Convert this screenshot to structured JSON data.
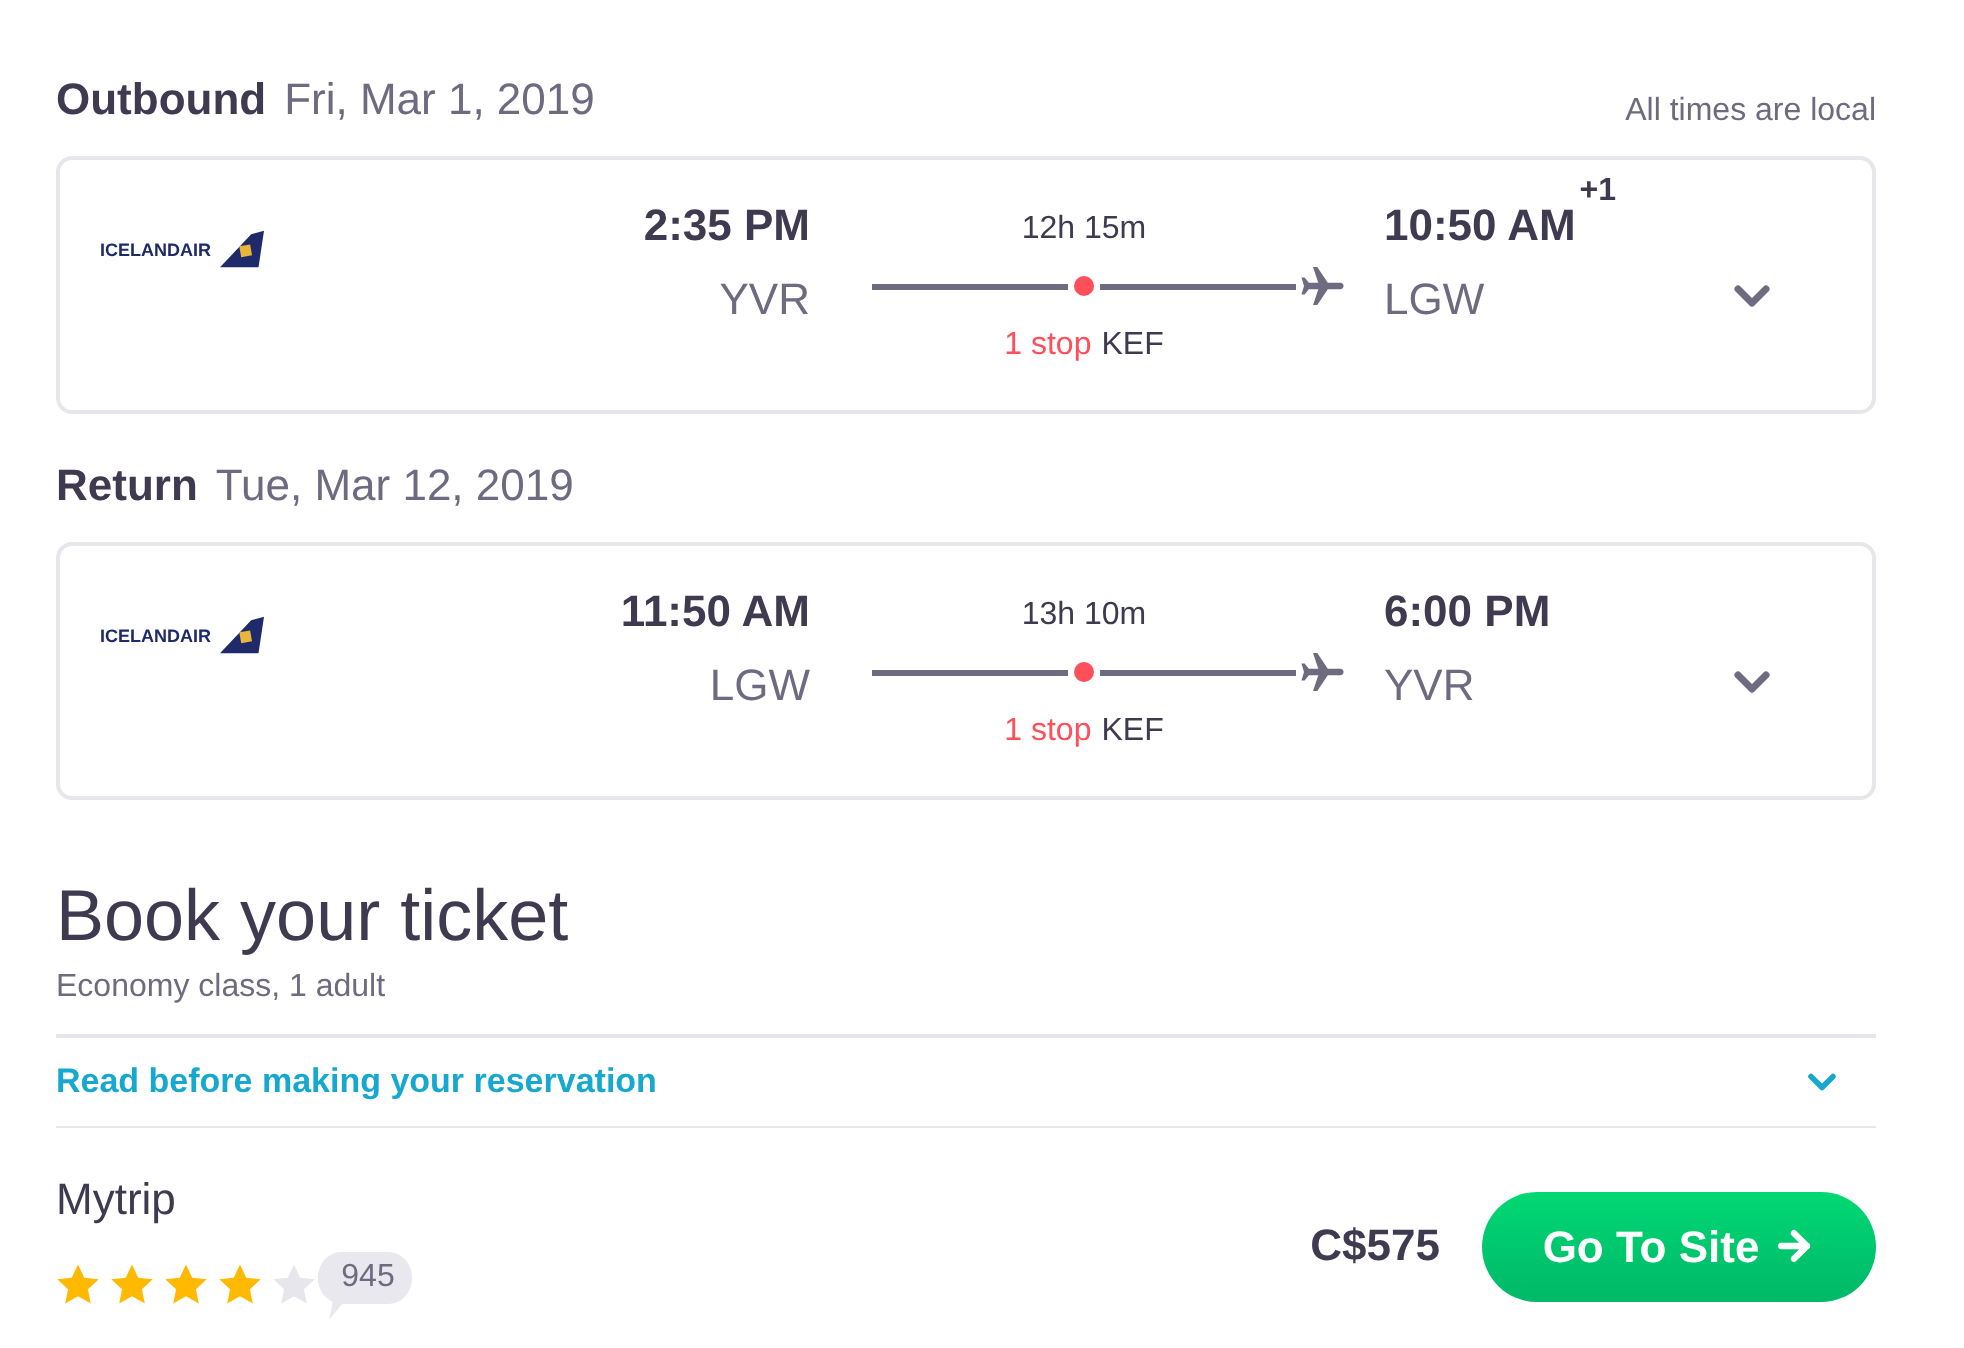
{
  "timezone_note": "All times are local",
  "legs": [
    {
      "label": "Outbound",
      "date": "Fri, Mar 1, 2019",
      "airline": "ICELANDAIR",
      "departure": {
        "time": "2:35 PM",
        "airport": "YVR"
      },
      "duration": "12h 15m",
      "stops": "1 stop",
      "stop_airport": "KEF",
      "arrival": {
        "time": "10:50 AM",
        "airport": "LGW",
        "day_offset": "+1"
      },
      "expanded": false
    },
    {
      "label": "Return",
      "date": "Tue, Mar 12, 2019",
      "airline": "ICELANDAIR",
      "departure": {
        "time": "11:50 AM",
        "airport": "LGW"
      },
      "duration": "13h 10m",
      "stops": "1 stop",
      "stop_airport": "KEF",
      "arrival": {
        "time": "6:00 PM",
        "airport": "YVR"
      },
      "expanded": false
    }
  ],
  "booking": {
    "title": "Book your ticket",
    "subtitle": "Economy class, 1 adult",
    "notice": {
      "label": "Read before making your reservation",
      "expanded": false
    }
  },
  "offer": {
    "provider": "Mytrip",
    "stars": 4,
    "review_count": "945",
    "price": "C$575",
    "button": "Go To Site"
  }
}
